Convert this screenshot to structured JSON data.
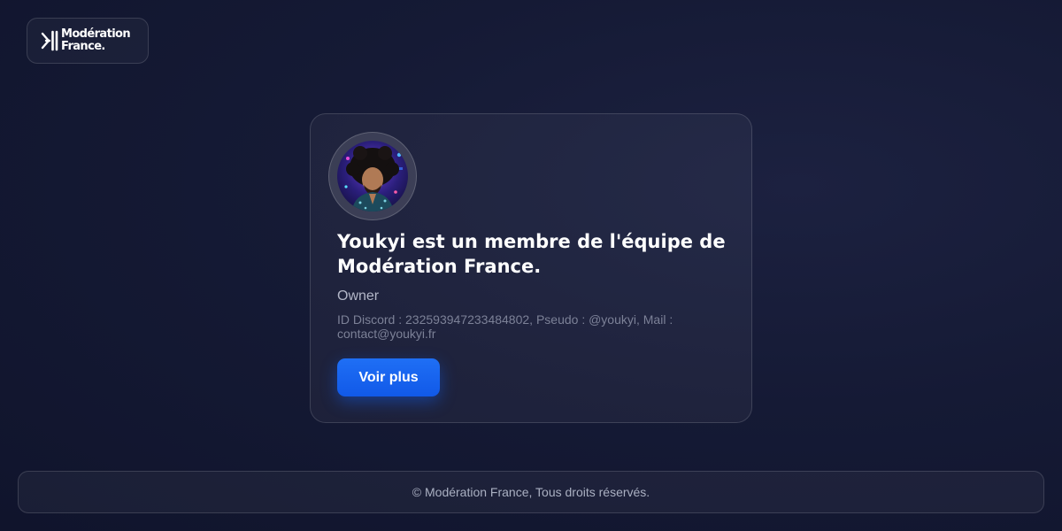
{
  "brand": {
    "line1": "Modération",
    "line2": "France.",
    "icon": "moderation-france-logo-mark"
  },
  "member": {
    "avatar_icon": "member-avatar-photo",
    "title": "Youkyi est un membre de l'équipe de Modération France.",
    "role": "Owner",
    "details": "ID Discord : 232593947233484802, Pseudo : @youkyi, Mail : contact@youkyi.fr",
    "button_label": "Voir plus"
  },
  "footer": {
    "text": "© Modération France, Tous droits réservés."
  },
  "colors": {
    "background": "#151a35",
    "accent": "#1f6ff5",
    "text_primary": "#ffffff",
    "text_secondary": "#b3b7c8",
    "text_muted": "#7c8197"
  }
}
